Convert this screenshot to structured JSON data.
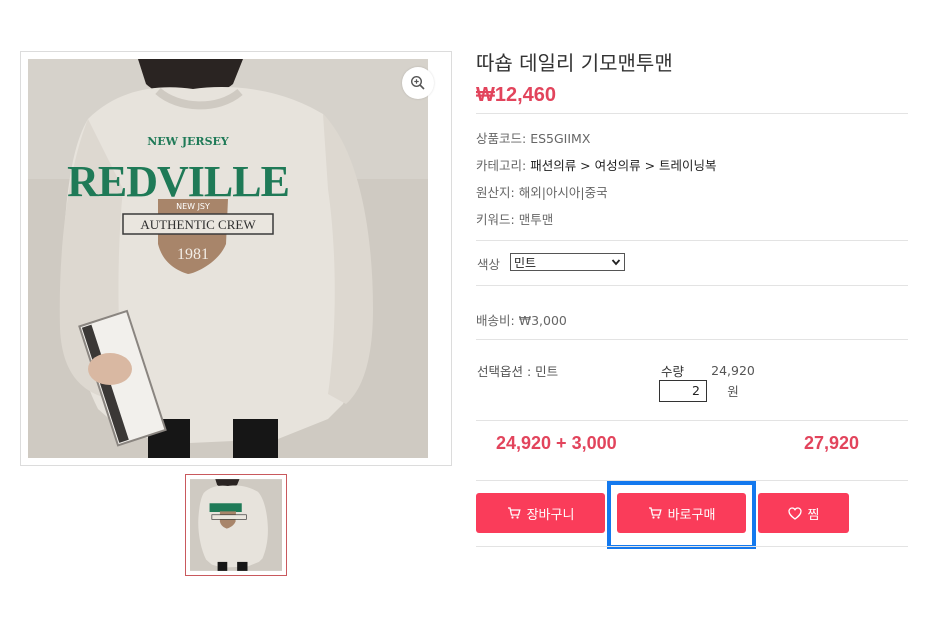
{
  "product": {
    "title": "따숍 데일리 기모맨투맨",
    "price": "₩12,460"
  },
  "info": {
    "code_label": "상품코드:",
    "code_value": "ES5GIIMX",
    "category_label": "카테고리:",
    "category_value": "패션의류 > 여성의류 > 트레이닝복",
    "origin_label": "원산지:",
    "origin_value": "해외|아시아|중국",
    "keyword_label": "키워드:",
    "keyword_value": "맨투맨"
  },
  "option": {
    "color_label": "색상",
    "color_selected": "민트"
  },
  "shipping": {
    "label": "배송비:",
    "value": "₩3,000"
  },
  "selection": {
    "selected_label": "선택옵션 : 민트",
    "qty_label": "수량",
    "qty_value": "2",
    "line_price": "24,920",
    "line_unit": "원"
  },
  "totals": {
    "formula": "24,920 + 3,000",
    "total": "27,920"
  },
  "buttons": {
    "cart": "장바구니",
    "buy": "바로구매",
    "wish": "찜"
  },
  "image_text": {
    "arc": "NEW JERSEY",
    "big": "REDVILLE",
    "badge": "NEW JSY",
    "banner": "AUTHENTIC CREW",
    "year": "1981"
  },
  "colors": {
    "accent": "#e2445c",
    "button": "#fa3c5a",
    "highlight": "#1479ee",
    "print_green": "#1f7a57"
  },
  "icons": {
    "zoom": "zoom-in-icon",
    "cart": "cart-icon",
    "buy": "cart-icon",
    "wish": "heart-icon",
    "select": "chevron-down-icon"
  }
}
